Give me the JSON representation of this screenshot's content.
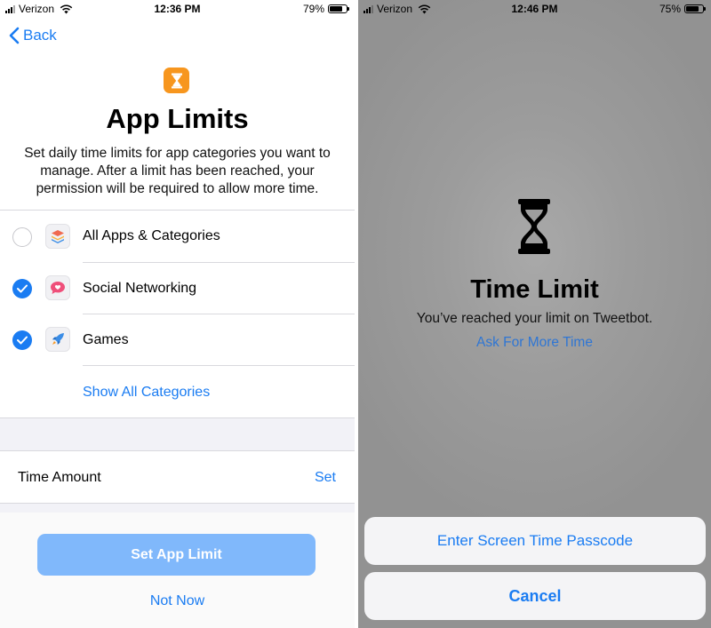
{
  "left": {
    "status": {
      "carrier": "Verizon",
      "time": "12:36 PM",
      "battery": "79%",
      "battery_level": 0.79
    },
    "nav": {
      "back_label": "Back"
    },
    "title": "App Limits",
    "description": "Set daily time limits for app categories you want to manage. After a limit has been reached, your permission will be required to allow more time.",
    "categories": [
      {
        "label": "All Apps & Categories",
        "checked": false,
        "icon": "stack-icon"
      },
      {
        "label": "Social Networking",
        "checked": true,
        "icon": "speech-heart-icon"
      },
      {
        "label": "Games",
        "checked": true,
        "icon": "rocket-icon"
      }
    ],
    "show_all": "Show All Categories",
    "time_amount": {
      "label": "Time Amount",
      "action": "Set"
    },
    "set_button": "Set App Limit",
    "not_now": "Not Now"
  },
  "right": {
    "status": {
      "carrier": "Verizon",
      "time": "12:46 PM",
      "battery": "75%",
      "battery_level": 0.75
    },
    "title": "Time Limit",
    "message": "You’ve reached your limit on Tweetbot.",
    "ask": "Ask For More Time",
    "passcode_button": "Enter Screen Time Passcode",
    "cancel_button": "Cancel"
  },
  "colors": {
    "accent": "#1a7cf2",
    "icon_orange": "#f7961e",
    "disabled_button": "#80b8fb"
  }
}
